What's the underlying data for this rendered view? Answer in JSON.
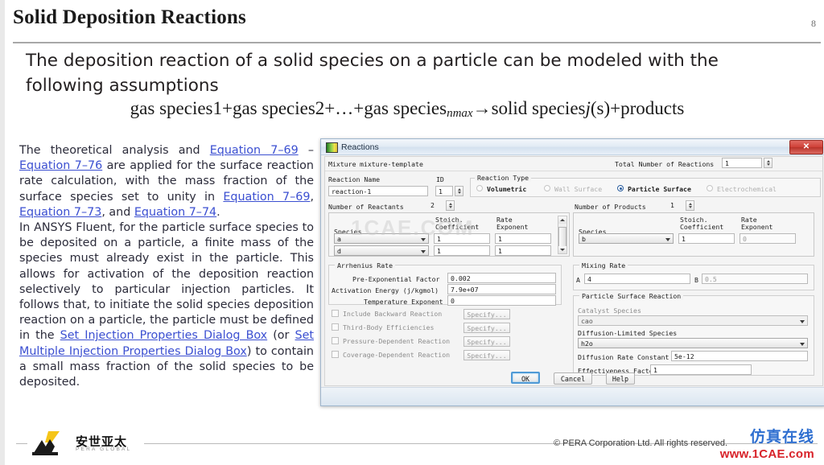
{
  "slide": {
    "title": "Solid Deposition Reactions",
    "page_number": "8",
    "intro": "The deposition reaction of a solid species on a particle can be modeled with the following assumptions",
    "equation": {
      "lead": "gas species1+gas species2+…+gas species",
      "sub": "nmax",
      "arrow": "→",
      "mid": "solid species",
      "ital": "j",
      "tail": "(s)+products"
    }
  },
  "body": {
    "para1": {
      "t1": "The theoretical analysis and ",
      "l1": "Equation 7–69",
      "t2": " – ",
      "l2": "Equation 7–76",
      "t3": " are applied for the surface reaction rate calculation, with the mass fraction of the surface species set to unity in ",
      "l3": "Equation 7–69",
      "t4": ", ",
      "l4": "Equation 7–73",
      "t5": ", and ",
      "l5": "Equation 7–74",
      "t6": "."
    },
    "para2": {
      "t1": "In ANSYS Fluent, for the particle surface species to be deposited on a particle, a finite mass of the species must already exist in the particle. This allows for activation of the deposition reaction selectively to particular injection particles. It follows that, to initiate the solid species deposition reaction on a particle, the particle must be defined in the ",
      "l1": "Set Injection Properties Dialog Box",
      "t2": " (or ",
      "l2": "Set Multiple Injection Properties Dialog Box",
      "t3": ") to contain a small mass fraction of the solid species to be deposited."
    }
  },
  "dialog": {
    "title": "Reactions",
    "close_label": "✕",
    "mixture_label": "Mixture",
    "mixture_value": "mixture-template",
    "total_reactions_label": "Total Number of Reactions",
    "total_reactions_value": "1",
    "reaction_name_label": "Reaction Name",
    "reaction_name_value": "reaction-1",
    "id_label": "ID",
    "id_value": "1",
    "reaction_type_label": "Reaction Type",
    "reaction_types": [
      {
        "label": "Volumetric",
        "selected": false,
        "disabled": false
      },
      {
        "label": "Wall Surface",
        "selected": false,
        "disabled": true
      },
      {
        "label": "Particle Surface",
        "selected": true,
        "disabled": false
      },
      {
        "label": "Electrochemical",
        "selected": false,
        "disabled": true
      }
    ],
    "reactants": {
      "count_label": "Number of Reactants",
      "count_value": "2",
      "headers": {
        "species": "Species",
        "stoich": "Stoich.\nCoefficient",
        "rate": "Rate\nExponent"
      },
      "rows": [
        {
          "species": "a",
          "stoich": "1",
          "rate": "1"
        },
        {
          "species": "d",
          "stoich": "1",
          "rate": "1"
        }
      ]
    },
    "products": {
      "count_label": "Number of Products",
      "count_value": "1",
      "headers": {
        "species": "Species",
        "stoich": "Stoich.\nCoefficient",
        "rate": "Rate\nExponent"
      },
      "rows": [
        {
          "species": "b",
          "stoich": "1",
          "rate": "0"
        }
      ]
    },
    "arrhenius": {
      "group_label": "Arrhenius Rate",
      "pre_exp_label": "Pre-Exponential Factor",
      "pre_exp_value": "0.002",
      "activation_label": "Activation Energy (j/kgmol)",
      "activation_value": "7.9e+07",
      "temp_exp_label": "Temperature Exponent",
      "temp_exp_value": "0"
    },
    "options": [
      {
        "label": "Include Backward Reaction",
        "checked": false,
        "button": "Specify..."
      },
      {
        "label": "Third-Body Efficiencies",
        "checked": false,
        "button": "Specify..."
      },
      {
        "label": "Pressure-Dependent Reaction",
        "checked": false,
        "button": "Specify..."
      },
      {
        "label": "Coverage-Dependent Reaction",
        "checked": false,
        "button": "Specify..."
      }
    ],
    "mixing_rate": {
      "group_label": "Mixing Rate",
      "a_label": "A",
      "a_value": "4",
      "b_label": "B",
      "b_value": "0.5"
    },
    "particle_surface": {
      "group_label": "Particle Surface Reaction",
      "catalyst_label": "Catalyst Species",
      "catalyst_value": "cao",
      "diffusion_species_label": "Diffusion-Limited Species",
      "diffusion_species_value": "h2o",
      "diffusion_rate_label": "Diffusion Rate Constant",
      "diffusion_rate_value": "5e-12",
      "effectiveness_label": "Effectiveness Factor",
      "effectiveness_value": "1"
    },
    "buttons": {
      "ok": "OK",
      "cancel": "Cancel",
      "help": "Help"
    }
  },
  "footer": {
    "logo_cn": "安世亚太",
    "logo_en": "PERA GLOBAL",
    "copyright": "© PERA Corporation Ltd. All rights reserved.",
    "watermark_cn": "仿真在线",
    "watermark_url": "www.1CAE.com",
    "background_watermark": "1CAE.COM"
  }
}
